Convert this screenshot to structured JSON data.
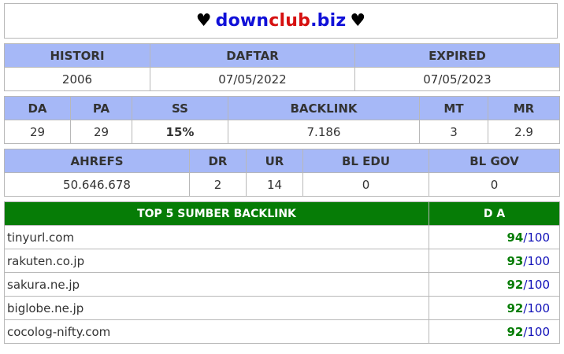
{
  "title": {
    "heart": "♥",
    "part1": "down",
    "part2": "club",
    "part3": ".biz"
  },
  "registration": {
    "headers": [
      "HISTORI",
      "DAFTAR",
      "EXPIRED"
    ],
    "values": [
      "2006",
      "07/05/2022",
      "07/05/2023"
    ]
  },
  "metrics": {
    "headers": [
      "DA",
      "PA",
      "SS",
      "BACKLINK",
      "MT",
      "MR"
    ],
    "values": [
      "29",
      "29",
      "15%",
      "7.186",
      "3",
      "2.9"
    ]
  },
  "ahrefs": {
    "headers": [
      "AHREFS",
      "DR",
      "UR",
      "BL EDU",
      "BL GOV"
    ],
    "values": [
      "50.646.678",
      "2",
      "14",
      "0",
      "0"
    ]
  },
  "backlinks": {
    "header_source": "TOP 5 SUMBER BACKLINK",
    "header_da": "D A",
    "max": "/100",
    "rows": [
      {
        "site": "tinyurl.com",
        "da": "94"
      },
      {
        "site": "rakuten.co.jp",
        "da": "93"
      },
      {
        "site": "sakura.ne.jp",
        "da": "92"
      },
      {
        "site": "biglobe.ne.jp",
        "da": "92"
      },
      {
        "site": "cocolog-nifty.com",
        "da": "92"
      }
    ]
  },
  "colors": {
    "header_bg": "#a6b8f7",
    "backlink_header_bg": "#067c06",
    "ss_value": "#19c7c7",
    "da_value": "#067c06",
    "da_max": "#1010b8",
    "title_blue": "#1010d8",
    "title_red": "#d61010"
  }
}
